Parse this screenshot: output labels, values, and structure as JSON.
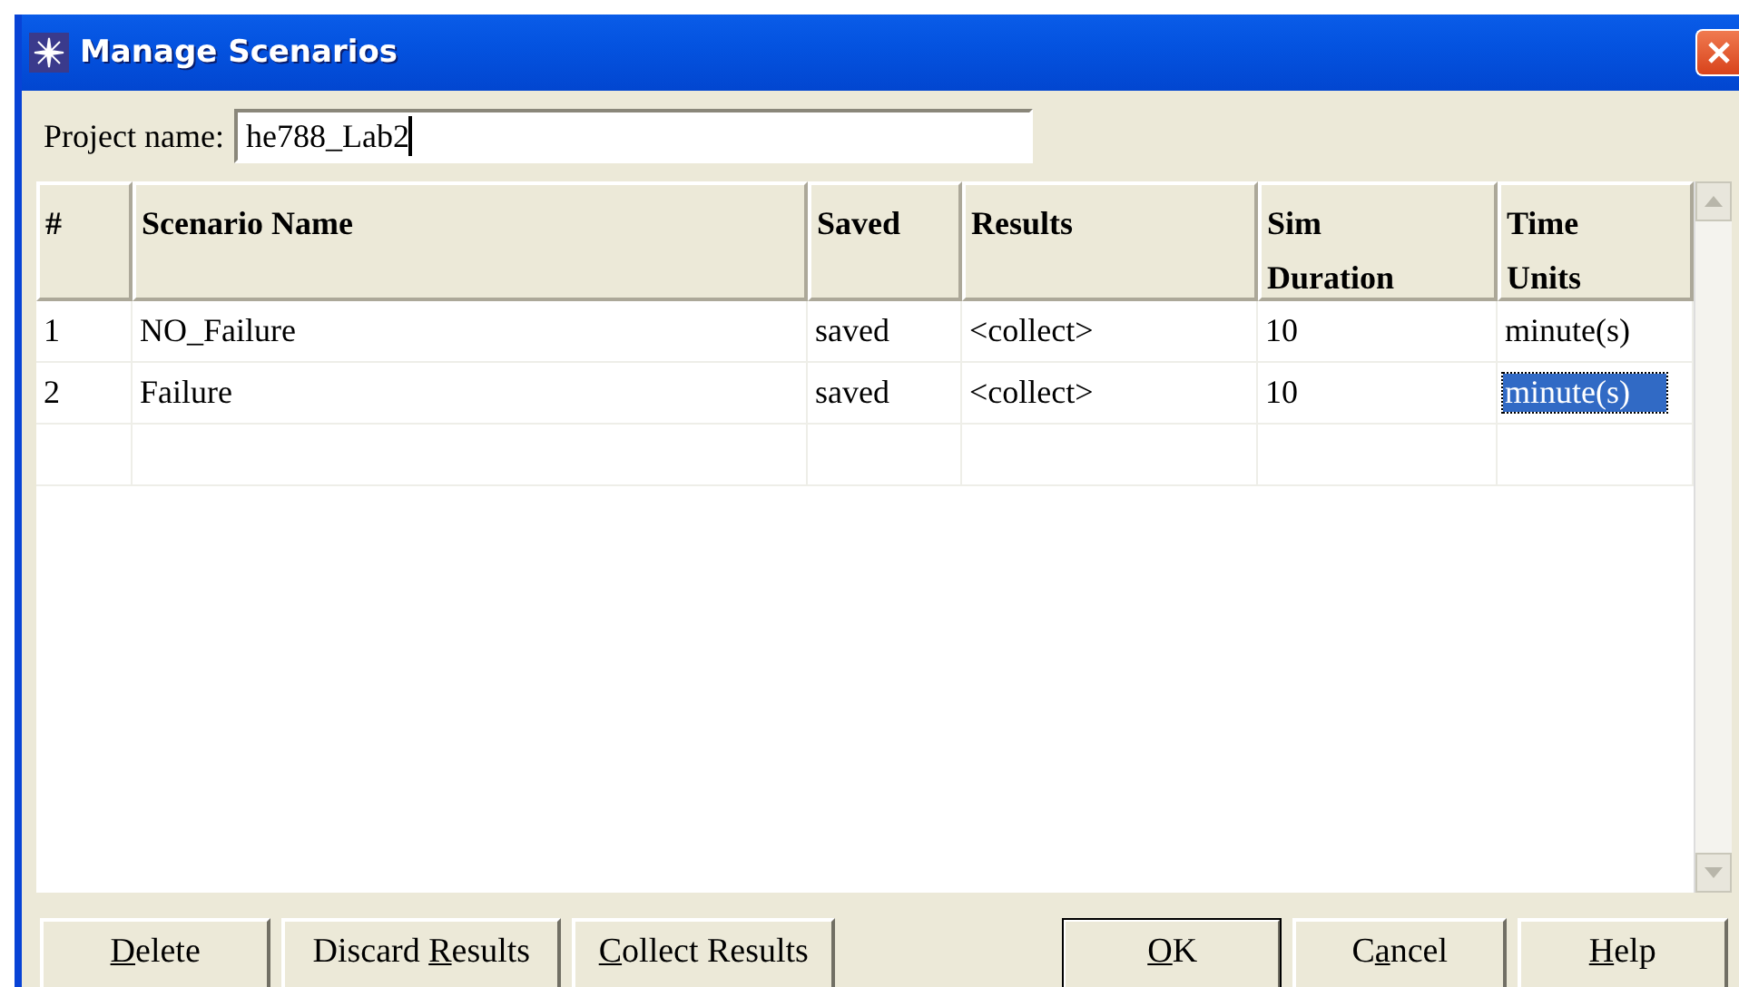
{
  "window": {
    "title": "Manage Scenarios"
  },
  "project": {
    "label": "Project name:",
    "value": "he788_Lab2"
  },
  "table": {
    "columns": [
      {
        "lines": [
          "#"
        ]
      },
      {
        "lines": [
          "Scenario Name"
        ]
      },
      {
        "lines": [
          "Saved"
        ]
      },
      {
        "lines": [
          "Results"
        ]
      },
      {
        "lines": [
          "Sim",
          "Duration"
        ]
      },
      {
        "lines": [
          "Time",
          "Units"
        ]
      }
    ],
    "rows": [
      {
        "cells": [
          {
            "text": "1",
            "selected": false
          },
          {
            "text": "NO_Failure",
            "selected": false
          },
          {
            "text": "saved",
            "selected": false
          },
          {
            "text": "<collect>",
            "selected": false
          },
          {
            "text": "10",
            "selected": false
          },
          {
            "text": "minute(s)",
            "selected": false
          }
        ]
      },
      {
        "cells": [
          {
            "text": "2",
            "selected": false
          },
          {
            "text": "Failure",
            "selected": false
          },
          {
            "text": "saved",
            "selected": false
          },
          {
            "text": "<collect>",
            "selected": false
          },
          {
            "text": "10",
            "selected": false
          },
          {
            "text": "minute(s)",
            "selected": true
          }
        ]
      }
    ]
  },
  "buttons_left": [
    {
      "key": "D",
      "post": "elete",
      "default": false
    },
    {
      "pre": "Discard ",
      "key": "R",
      "post": "esults",
      "default": false
    },
    {
      "key": "C",
      "post": "ollect Results",
      "default": false
    }
  ],
  "buttons_right": [
    {
      "key": "O",
      "post": "K",
      "default": true
    },
    {
      "pre": "C",
      "key": "a",
      "post": "ncel",
      "default": false
    },
    {
      "key": "H",
      "post": "elp",
      "default": false
    }
  ]
}
